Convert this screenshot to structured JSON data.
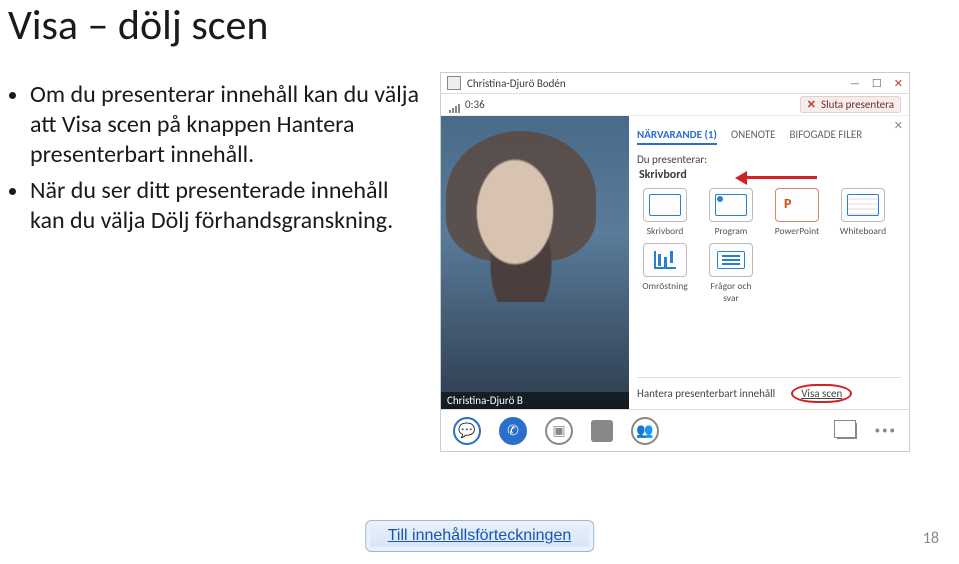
{
  "title": "Visa – dölj scen",
  "bullets": [
    "Om du presenterar innehåll kan du välja att Visa scen på knappen Hantera presenterbart innehåll.",
    "När du ser ditt presenterade innehåll kan du välja Dölj förhandsgranskning."
  ],
  "bottom_button": "Till innehållsförteckningen",
  "page_num": "18",
  "screenshot": {
    "window_user": "Christina-Djurö Bodén",
    "time": "0:36",
    "stop_present": "Sluta presentera",
    "video_caption": "Christina-Djurö B",
    "panel": {
      "tabs": {
        "active": "NÄRVARANDE (1)",
        "t2": "ONENOTE",
        "t3": "BIFOGADE FILER"
      },
      "presenting_lbl": "Du presenterar:",
      "presenting_val": "Skrivbord",
      "grid": {
        "skrivbord": "Skrivbord",
        "program": "Program",
        "powerpoint": "PowerPoint",
        "whiteboard": "Whiteboard",
        "omrostning": "Omröstning",
        "fragor": "Frågor och svar"
      },
      "footer": {
        "manage": "Hantera presenterbart innehåll",
        "visa_scen": "Visa scen"
      }
    }
  }
}
